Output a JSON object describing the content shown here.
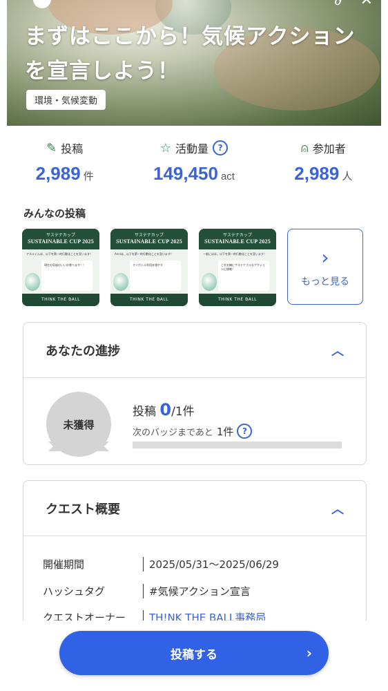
{
  "hero": {
    "title_line1": "まずはここから！気候アクション",
    "title_line2": "を宣言しよう！",
    "tag": "環境・気候変動"
  },
  "stats": [
    {
      "label": "投稿",
      "value": "2,989",
      "unit": "件",
      "icon": "edit-icon"
    },
    {
      "label": "活動量",
      "value": "149,450",
      "unit": "act",
      "icon": "star-icon",
      "help": "?"
    },
    {
      "label": "参加者",
      "value": "2,989",
      "unit": "人",
      "icon": "person-icon"
    }
  ],
  "posts_section": {
    "title": "みんなの投稿",
    "more_label": "もっと見る",
    "items": [
      {
        "kana": "サステナカップ",
        "cup": "SUSTAINABLE CUP 2025",
        "line": "アスルくんは、以下を第一的行動化ことを宣います！",
        "card": "現在の気候のいいの食べます！！",
        "footer": "THINK THE BALL"
      },
      {
        "kana": "サステナカップ",
        "cup": "SUSTAINABLE CUP 2025",
        "line": "Anniは、以下を第一的行動化ことを宣います！",
        "card": "マイボトル利用を増やす",
        "footer": "THINK THE BALL"
      },
      {
        "kana": "サステナカップ",
        "cup": "SUSTAINABLE CUP 2025",
        "line": "一般にはは、以下を第一的行動化ことを宣います！",
        "card": "これを機にサステナブルなアクションに挑戦！",
        "footer": "THINK THE BALL"
      }
    ]
  },
  "progress": {
    "title": "あなたの進捗",
    "badge": "未獲得",
    "post_label": "投稿",
    "current": "0",
    "total": "/1件",
    "next_text": "次のバッジまであと",
    "next_count": "1件",
    "help": "?",
    "fraction": 0
  },
  "quest": {
    "title": "クエスト概要",
    "rows": [
      {
        "key": "開催期間",
        "value": "2025/05/31～2025/06/29"
      },
      {
        "key": "ハッシュタグ",
        "value": "#気候アクション宣言"
      },
      {
        "key": "クエストオーナー",
        "value": "TH!NK THE BALL事務局"
      }
    ]
  },
  "cta": {
    "label": "投稿する"
  },
  "colors": {
    "accent": "#3b63d6",
    "cta": "#3162e6",
    "green": "#2b8a4a"
  }
}
